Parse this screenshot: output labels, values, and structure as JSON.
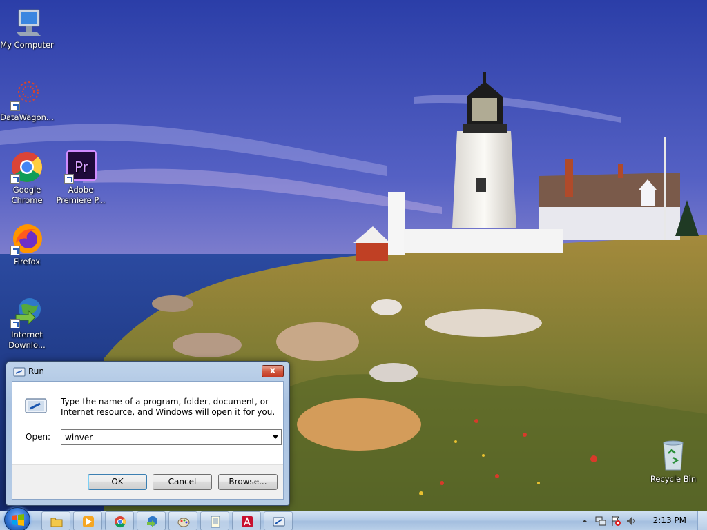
{
  "desktop": {
    "icons": [
      {
        "label": "My Computer",
        "icon": "computer-icon"
      },
      {
        "label": "DataWagon...",
        "icon": "datawagon-icon"
      },
      {
        "label": "Google Chrome",
        "icon": "chrome-icon"
      },
      {
        "label": "Adobe Premiere P...",
        "icon": "premiere-icon",
        "glyph": "Pr"
      },
      {
        "label": "Firefox",
        "icon": "firefox-icon"
      },
      {
        "label": "Internet Downlo...",
        "icon": "idm-icon"
      },
      {
        "label": "Recycle Bin",
        "icon": "recycle-bin-icon"
      }
    ]
  },
  "run_dialog": {
    "title": "Run",
    "message": "Type the name of a program, folder, document, or Internet resource, and Windows will open it for you.",
    "open_label": "Open:",
    "open_value": "winver",
    "ok_label": "OK",
    "cancel_label": "Cancel",
    "browse_label": "Browse...",
    "close_glyph": "x"
  },
  "taskbar": {
    "items": [
      {
        "icon": "folder-icon"
      },
      {
        "icon": "media-player-icon"
      },
      {
        "icon": "chrome-icon"
      },
      {
        "icon": "idm-icon"
      },
      {
        "icon": "paint-icon"
      },
      {
        "icon": "notepad-icon"
      },
      {
        "icon": "acrobat-icon"
      },
      {
        "icon": "run-icon"
      }
    ],
    "clock": "2:13 PM"
  },
  "colors": {
    "sky_top": "#3a4fb0",
    "sea": "#1d3f8a",
    "grass": "#8a8a3a"
  }
}
